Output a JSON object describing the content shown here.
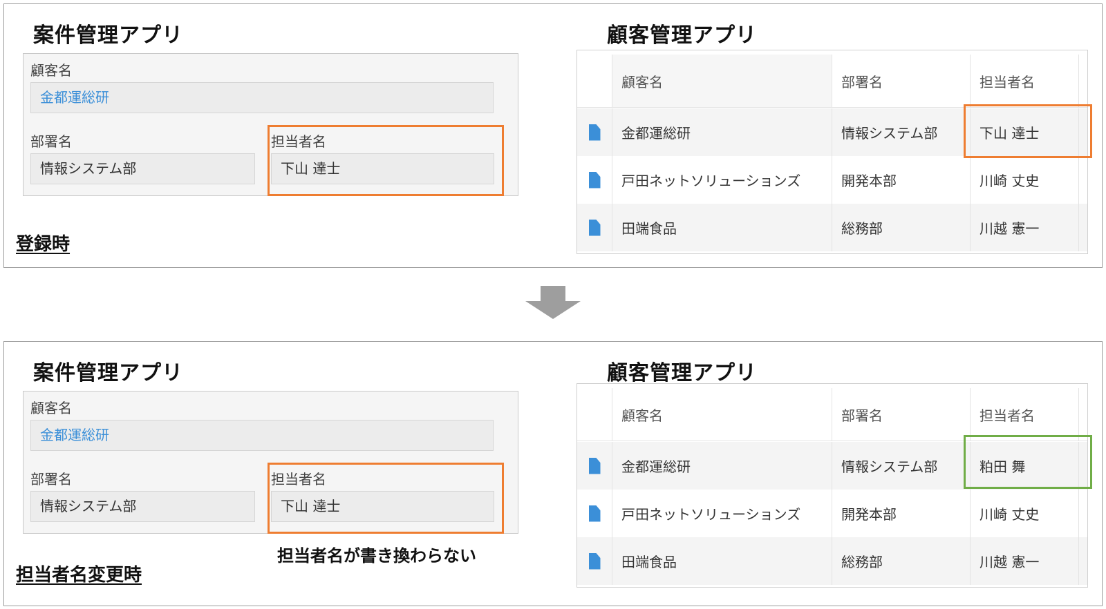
{
  "before": {
    "project_app_title": "案件管理アプリ",
    "customer_app_title": "顧客管理アプリ",
    "stage_label": "登録時",
    "form": {
      "customer_label": "顧客名",
      "customer_value": "金都運総研",
      "dept_label": "部署名",
      "dept_value": "情報システム部",
      "person_label": "担当者名",
      "person_value": "下山 達士"
    },
    "table": {
      "headers": [
        "顧客名",
        "部署名",
        "担当者名"
      ],
      "rows": [
        {
          "customer": "金都運総研",
          "dept": "情報システム部",
          "person": "下山 達士"
        },
        {
          "customer": "戸田ネットソリューションズ",
          "dept": "開発本部",
          "person": "川崎 丈史"
        },
        {
          "customer": "田端食品",
          "dept": "総務部",
          "person": "川越 憲一"
        }
      ]
    }
  },
  "after": {
    "project_app_title": "案件管理アプリ",
    "customer_app_title": "顧客管理アプリ",
    "stage_label": "担当者名変更時",
    "note": "担当者名が書き換わらない",
    "form": {
      "customer_label": "顧客名",
      "customer_value": "金都運総研",
      "dept_label": "部署名",
      "dept_value": "情報システム部",
      "person_label": "担当者名",
      "person_value": "下山 達士"
    },
    "table": {
      "headers": [
        "顧客名",
        "部署名",
        "担当者名"
      ],
      "rows": [
        {
          "customer": "金都運総研",
          "dept": "情報システム部",
          "person": "粕田 舞"
        },
        {
          "customer": "戸田ネットソリューションズ",
          "dept": "開発本部",
          "person": "川崎 丈史"
        },
        {
          "customer": "田端食品",
          "dept": "総務部",
          "person": "川越 憲一"
        }
      ]
    }
  },
  "colors": {
    "highlight_unchanged": "#ee7d31",
    "highlight_changed": "#70ad47",
    "link": "#3b8fd8",
    "arrow": "#9e9e9e"
  },
  "icons": [
    "document-icon",
    "down-arrow-icon"
  ]
}
